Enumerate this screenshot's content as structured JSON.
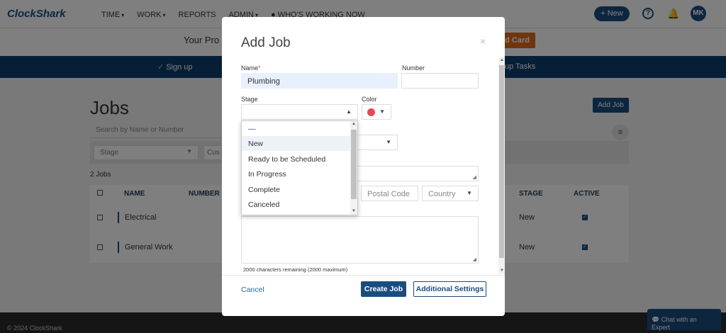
{
  "app": {
    "logo": "ClockShark",
    "nav": [
      {
        "label": "TIME",
        "chevron": "▾"
      },
      {
        "label": "WORK",
        "chevron": "▾"
      },
      {
        "label": "REPORTS",
        "chevron": ""
      },
      {
        "label": "ADMIN",
        "chevron": "▾"
      },
      {
        "label": "WHO'S WORKING NOW",
        "chevron": ""
      }
    ],
    "new_button": "+ New",
    "help_glyph": "?",
    "bell_glyph": "🔔",
    "avatar_initials": "MK"
  },
  "promo": {
    "text": "Your Pro",
    "button": "dd Card"
  },
  "steps": {
    "step1": "Sign up",
    "step2": "up Tasks"
  },
  "page": {
    "title": "Jobs",
    "add_job_button": "Add Job",
    "search_placeholder": "Search by Name or Number",
    "stage_filter": "Stage",
    "customer_filter": "Cus",
    "count": "2 Jobs",
    "columns": [
      "NAME",
      "NUMBER",
      "STAGE",
      "ACTIVE"
    ],
    "rows": [
      {
        "name": "Electrical",
        "stage": "New",
        "active": true
      },
      {
        "name": "General Work",
        "stage": "New",
        "active": true
      }
    ]
  },
  "footer": {
    "copyright": "© 2024 ClockShark",
    "chat_button": "Chat with an Expert"
  },
  "modal": {
    "title": "Add Job",
    "close_glyph": "×",
    "name_label": "Name",
    "name_required": "*",
    "name_value": "Plumbing",
    "number_label": "Number",
    "number_value": "",
    "stage_label": "Stage",
    "stage_value": "",
    "color_label": "Color",
    "color_value": "#e84856",
    "postal_placeholder": "Postal Code",
    "country_placeholder": "Country",
    "char_count": "2000 characters remaining (2000 maximum)",
    "cancel": "Cancel",
    "create": "Create Job",
    "additional_settings": "Additional Settings"
  },
  "stage_dropdown": {
    "options": [
      "—",
      "New",
      "Ready to be Scheduled",
      "In Progress",
      "Complete",
      "Canceled"
    ],
    "highlighted": "New"
  },
  "colors": {
    "brand": "#1b4c80",
    "steps_bar": "#0f3f6c",
    "promo_button": "#e06a1a",
    "selected_color": "#e84856"
  }
}
